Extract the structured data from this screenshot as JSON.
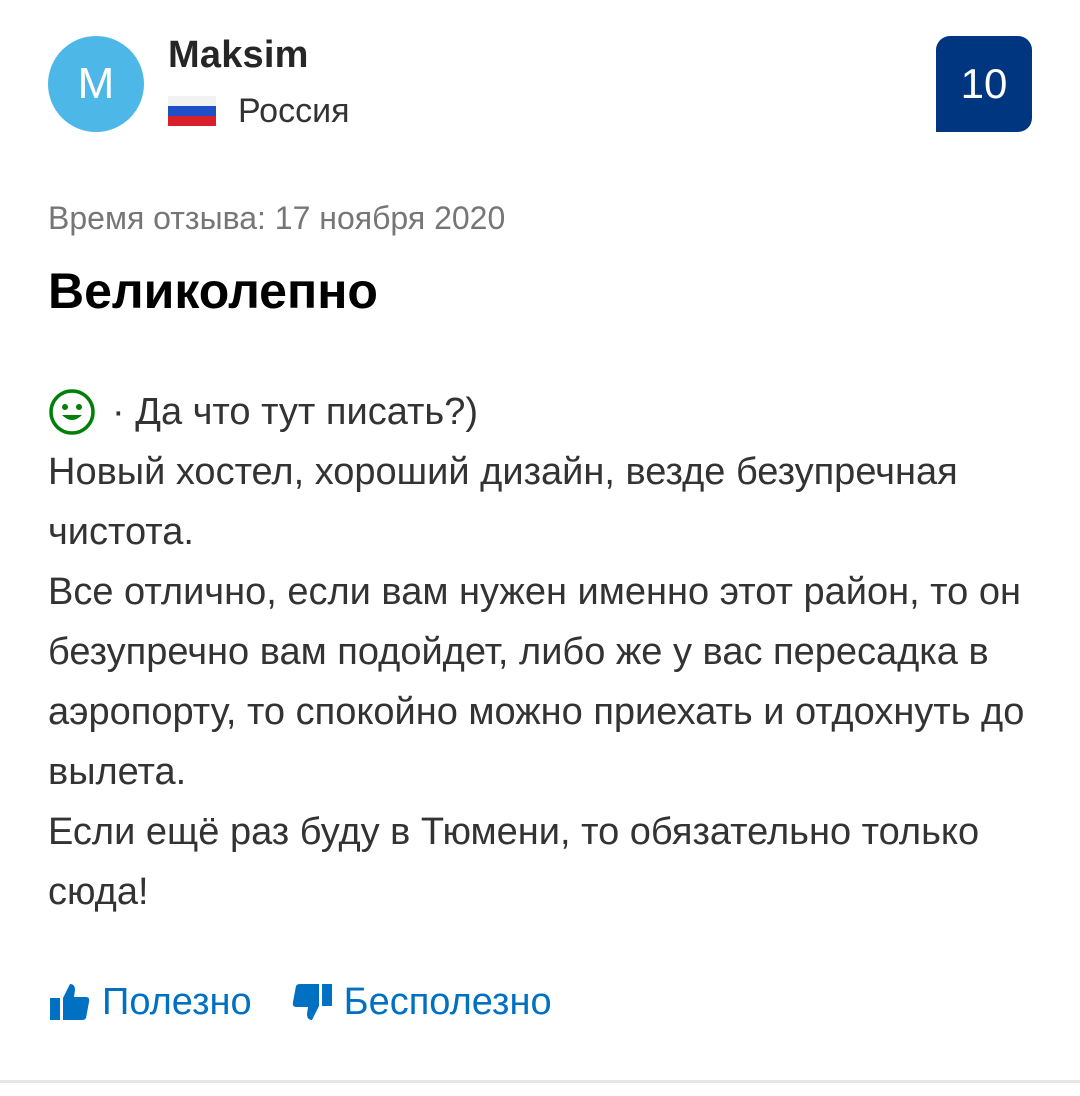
{
  "reviewer": {
    "avatar_letter": "M",
    "name": "Maksim",
    "country": "Россия",
    "flag_icon": "russia-flag-icon",
    "avatar_color": "#4db8e8"
  },
  "score": {
    "value": "10",
    "color": "#003580"
  },
  "review": {
    "date": "Время отзыва: 17 ноября 2020",
    "title": "Великолепно",
    "positive_icon": "smile-icon",
    "positive_label": "· Да что тут писать?)",
    "body": [
      "Новый хостел, хороший дизайн, везде безупречная чистота.",
      "Все отлично, если вам нужен именно этот район, то он безупречно вам подойдет, либо же у вас пересадка в аэропорту, то спокойно можно приехать и отдохнуть до вылета.",
      "Если ещё раз буду в Тюмени, то обязательно только сюда!"
    ]
  },
  "actions": {
    "helpful": "Полезно",
    "helpful_icon": "thumbs-up-icon",
    "not_helpful": "Бесполезно",
    "not_helpful_icon": "thumbs-down-icon",
    "link_color": "#0071c2"
  }
}
